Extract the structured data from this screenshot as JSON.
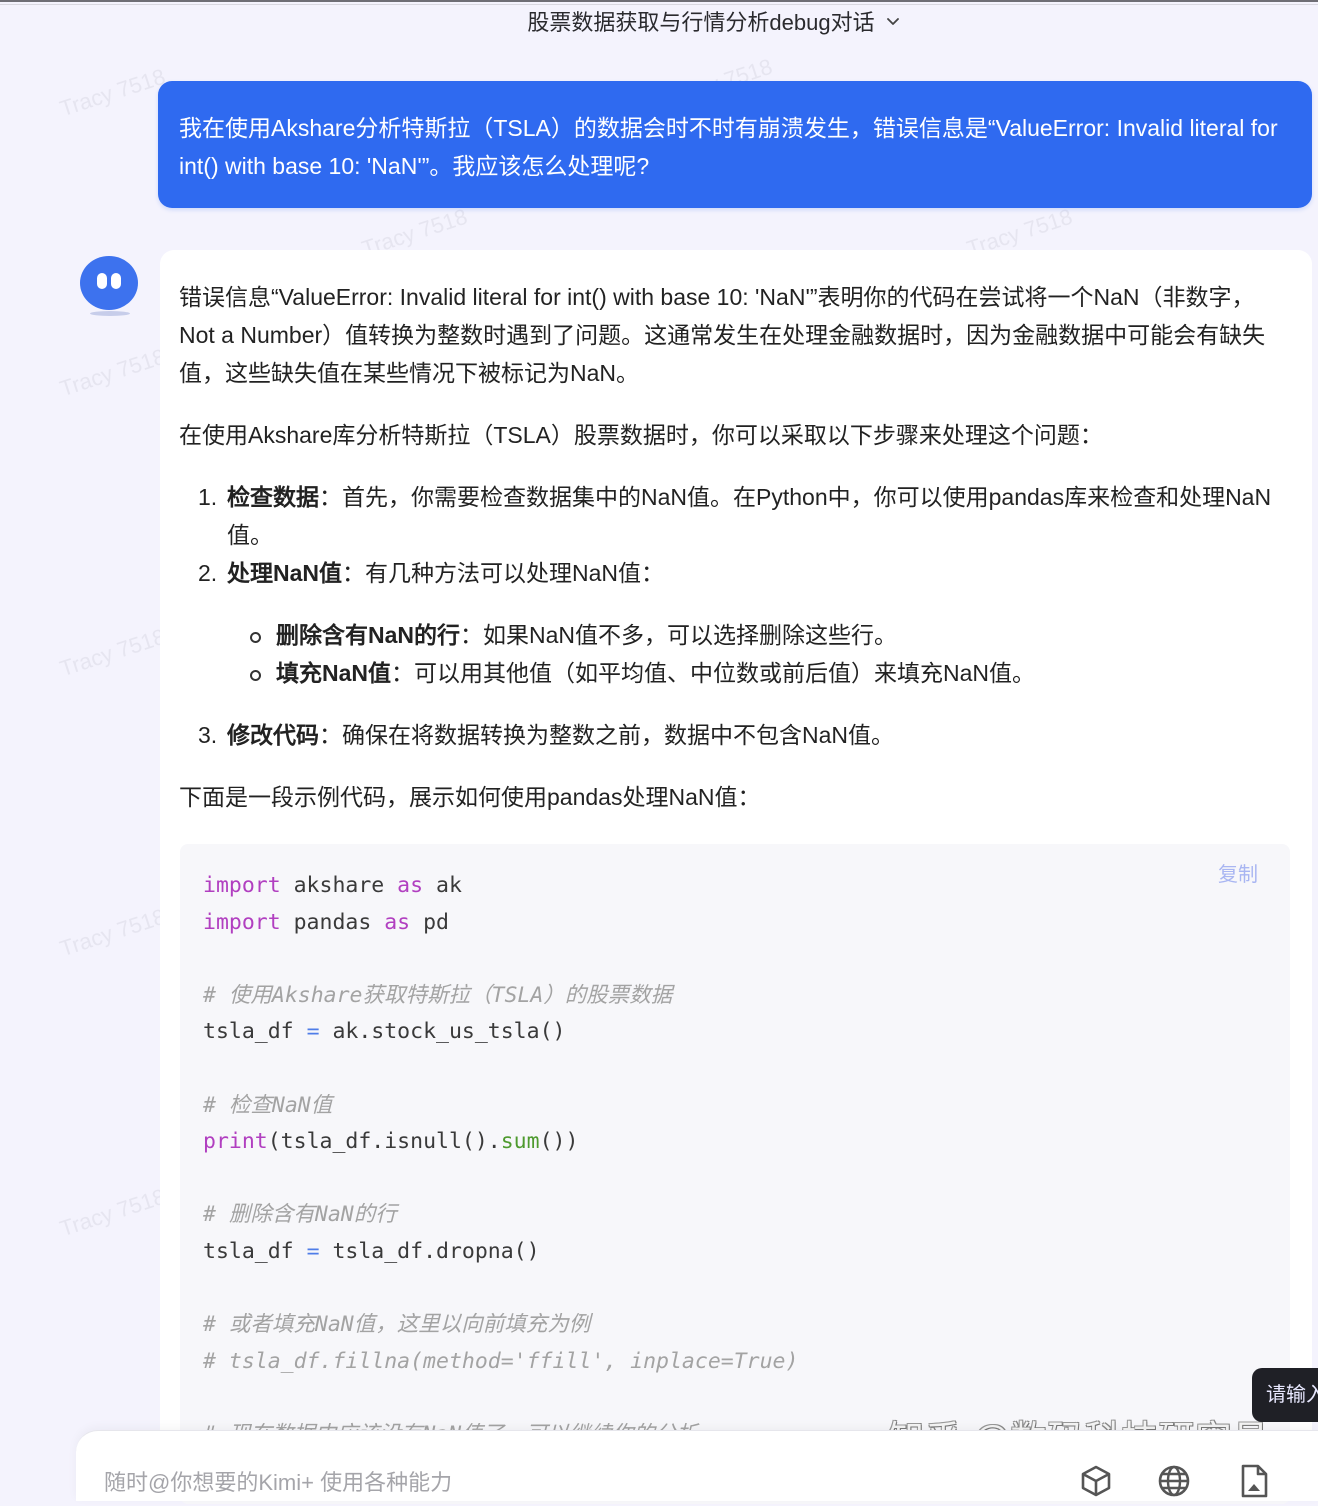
{
  "header": {
    "title": "股票数据获取与行情分析debug对话"
  },
  "user_message": {
    "text": "我在使用Akshare分析特斯拉（TSLA）的数据会时不时有崩溃发生，错误信息是“ValueError: Invalid literal for int() with base 10: 'NaN'”。我应该怎么处理呢?"
  },
  "assistant_message": {
    "intro": "错误信息“ValueError: Invalid literal for int() with base 10: 'NaN'”表明你的代码在尝试将一个NaN（非数字，Not a Number）值转换为整数时遇到了问题。这通常发生在处理金融数据时，因为金融数据中可能会有缺失值，这些缺失值在某些情况下被标记为NaN。",
    "lead": "在使用Akshare库分析特斯拉（TSLA）股票数据时，你可以采取以下步骤来处理这个问题：",
    "steps": [
      {
        "num": "1.",
        "title": "检查数据",
        "text": "：首先，你需要检查数据集中的NaN值。在Python中，你可以使用pandas库来检查和处理NaN值。"
      },
      {
        "num": "2.",
        "title": "处理NaN值",
        "text": "：有几种方法可以处理NaN值："
      },
      {
        "num": "3.",
        "title": "修改代码",
        "text": "：确保在将数据转换为整数之前，数据中不包含NaN值。"
      }
    ],
    "sub_steps": [
      {
        "title": "删除含有NaN的行",
        "text": "：如果NaN值不多，可以选择删除这些行。"
      },
      {
        "title": "填充NaN值",
        "text": "：可以用其他值（如平均值、中位数或前后值）来填充NaN值。"
      }
    ],
    "code_intro": "下面是一段示例代码，展示如何使用pandas处理NaN值：",
    "code": {
      "copy_label": "复制",
      "lines": {
        "l1_kw": "import",
        "l1_rest": " akshare ",
        "l1_kw2": "as",
        "l1_end": " ak",
        "l2_kw": "import",
        "l2_rest": " pandas ",
        "l2_kw2": "as",
        "l2_end": " pd",
        "c1": "# 使用Akshare获取特斯拉（TSLA）的股票数据",
        "l3_a": "tsla_df ",
        "l3_op": "=",
        "l3_b": " ak.stock_us_tsla()",
        "c2": "# 检查NaN值",
        "l4_fn": "print",
        "l4_a": "(tsla_df.isnull().",
        "l4_fn2": "sum",
        "l4_b": "())",
        "c3": "# 删除含有NaN的行",
        "l5_a": "tsla_df ",
        "l5_op": "=",
        "l5_b": " tsla_df.dropna()",
        "c4": "# 或者填充NaN值，这里以向前填充为例",
        "c5": "# tsla_df.fillna(method='ffill', inplace=True)",
        "c6": "# 现在数据中应该没有NaN值了，可以继续你的分析"
      }
    }
  },
  "input": {
    "placeholder": "随时@你想要的Kimi+ 使用各种能力",
    "tools": [
      "cube-icon",
      "globe-icon",
      "file-icon"
    ]
  },
  "tooltip": {
    "text": "请输入"
  },
  "watermarks": {
    "text": "Tracy 7518",
    "source": "知乎 @数码科技研究员"
  }
}
